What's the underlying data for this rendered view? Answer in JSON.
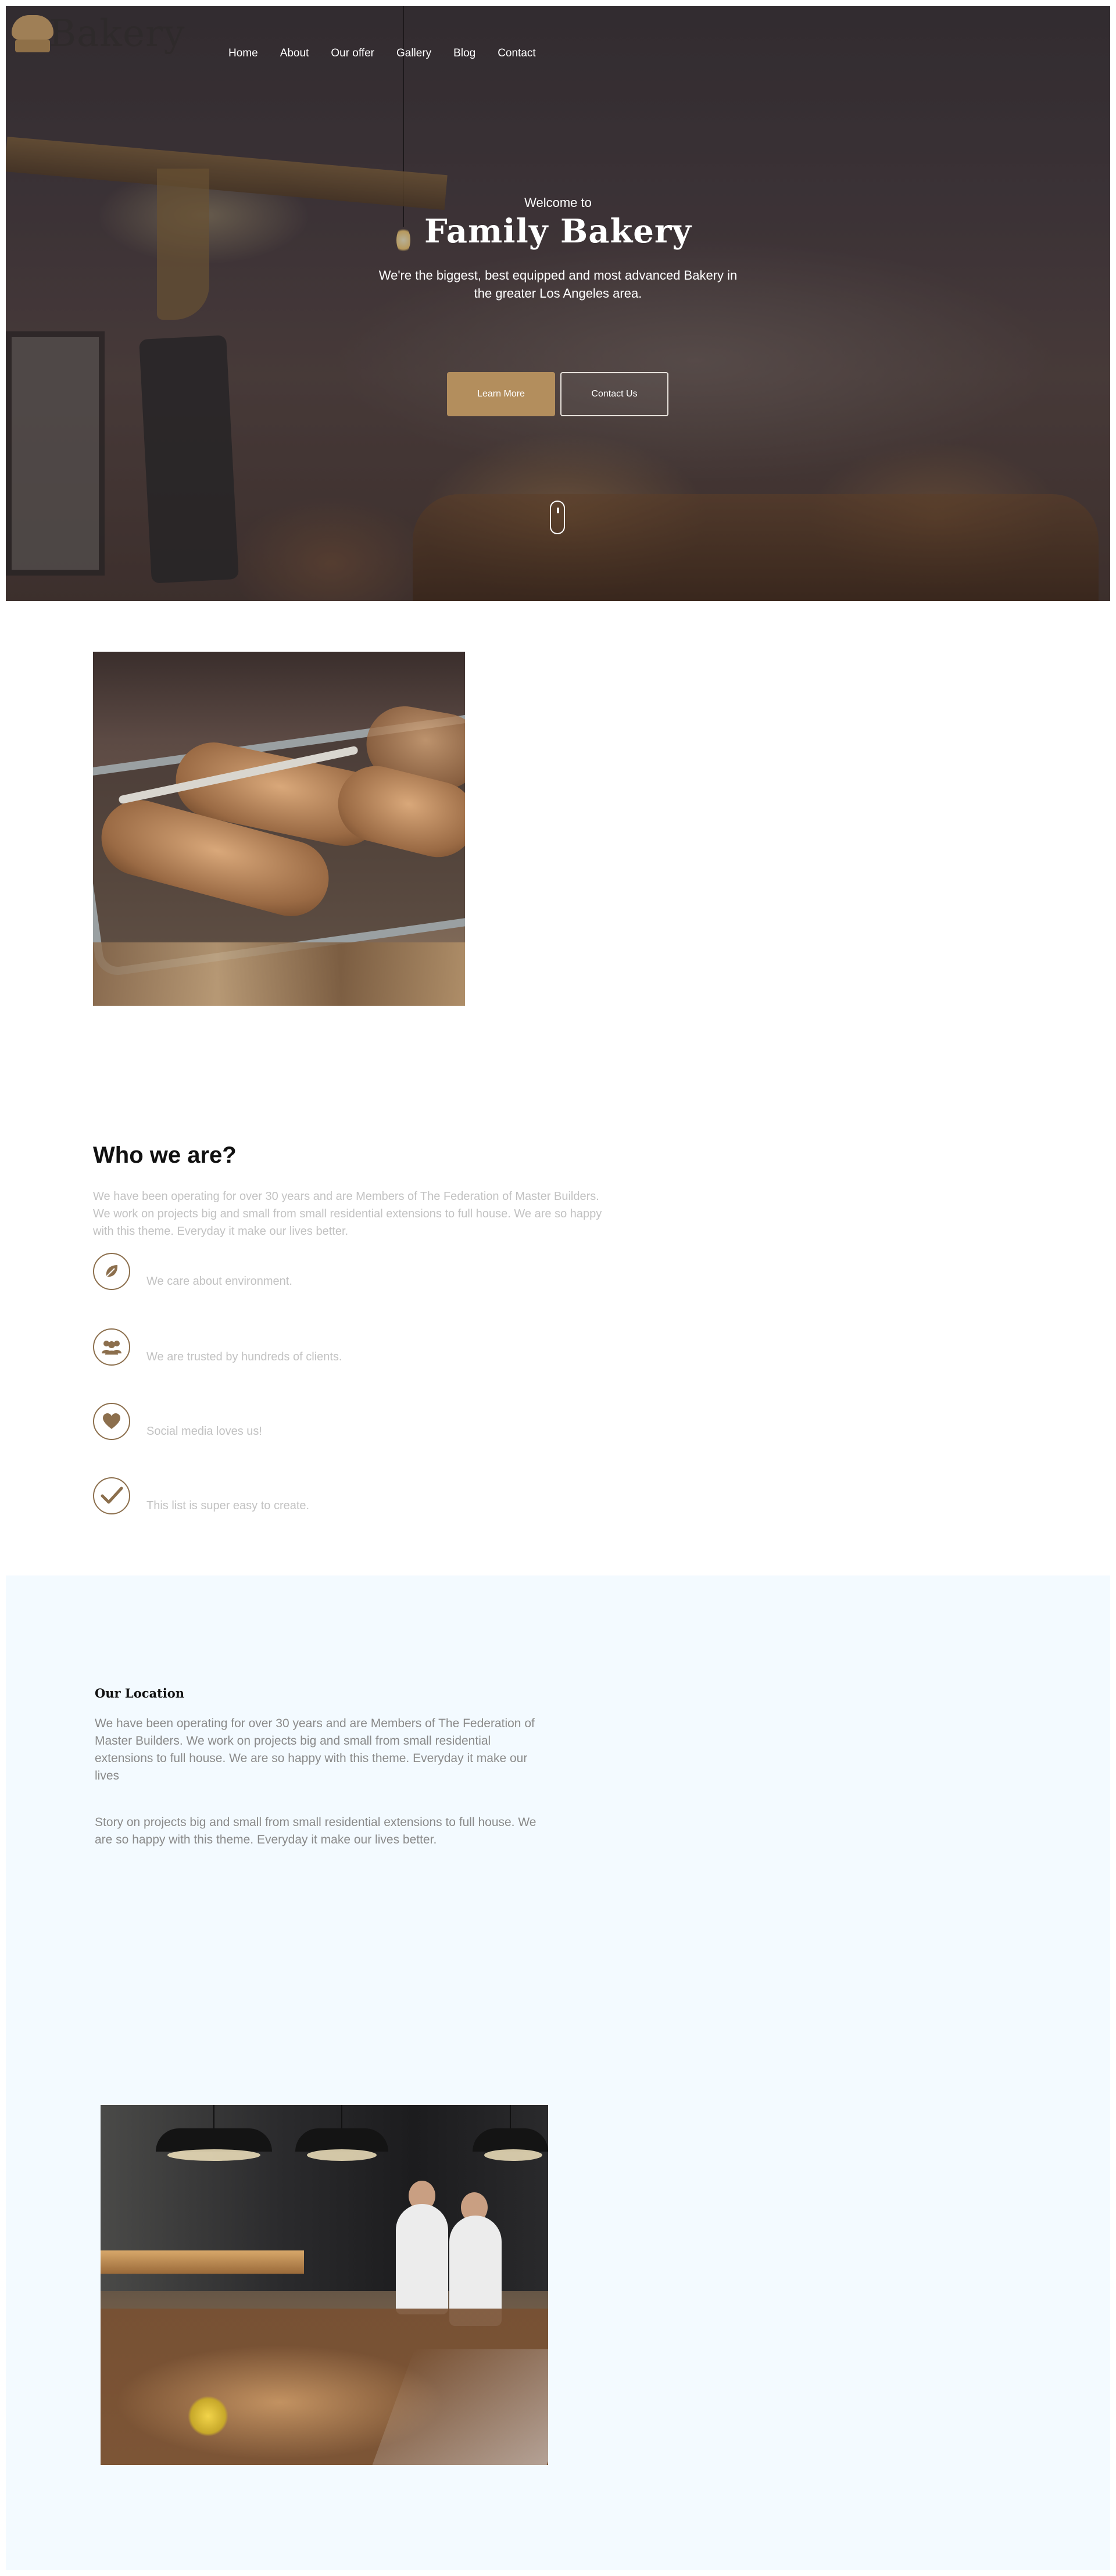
{
  "brand": {
    "name": "Bakery"
  },
  "nav": {
    "items": [
      "Home",
      "About",
      "Our offer",
      "Gallery",
      "Blog",
      "Contact"
    ]
  },
  "hero": {
    "welcome": "Welcome to",
    "title": "Family Bakery",
    "subtitle": "We're the biggest, best equipped and most advanced Bakery in the greater Los Angeles area.",
    "primary_button": "Learn More",
    "secondary_button": "Contact Us"
  },
  "who": {
    "title": "Who we are?",
    "text": "We have been operating for over 30 years and are Members of The Federation of Master Builders. We work on projects big and small from small residential extensions to full house. We are so happy with this theme. Everyday it make our lives better.",
    "features": [
      {
        "icon": "leaf-icon",
        "label": "We care about environment."
      },
      {
        "icon": "users-icon",
        "label": "We are trusted by hundreds of clients."
      },
      {
        "icon": "heart-icon",
        "label": "Social media loves us!"
      },
      {
        "icon": "checkmark-icon",
        "label": "This list is super easy to create."
      }
    ]
  },
  "location": {
    "title": "Our Location",
    "paragraph1": "We have been operating for over 30 years and are Members of The Federation of Master Builders. We work on projects big and small from small residential extensions to full house. We are so happy with this theme. Everyday it make our lives",
    "paragraph2": "Story on projects big and small from small residential extensions to full house. We are so happy with this theme. Everyday it make our lives better."
  },
  "colors": {
    "accent": "#b38e5d",
    "icon_border": "#8c6f4d",
    "location_bg": "#f3faff",
    "muted_text": "#c2c2c2"
  }
}
